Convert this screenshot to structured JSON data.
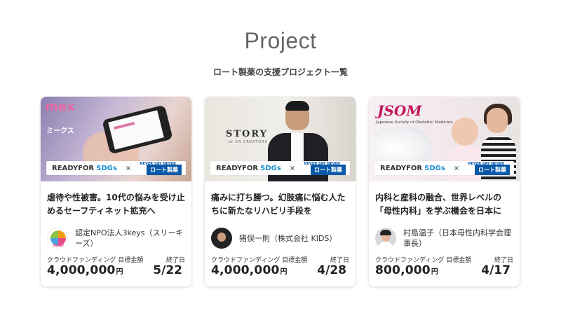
{
  "page": {
    "title": "Project",
    "subtitle": "ロート製薬の支援プロジェクト一覧"
  },
  "badge": {
    "readyfor": "READYFOR",
    "sdgs": "SDGs",
    "times": "×",
    "never_say_never": "NEVER SAY NEVER",
    "rohto": "ロート製薬"
  },
  "labels": {
    "crowdfunding": "クラウドファンディング",
    "goal_amount": "目標金額",
    "end_date": "終了日",
    "yen": "円"
  },
  "cards": [
    {
      "title": "虐待や性被害。10代の悩みを受け止めるセーフティネット拡充へ",
      "owner": "認定NPO法人3keys（スリーキーズ）",
      "amount": "4,000,000",
      "end": "5/22",
      "thumb_logo": "mex",
      "thumb_logo_sub": "ミークス",
      "owner_logo": "3keys"
    },
    {
      "title": "痛みに打ち勝つ。幻肢痛に悩む人たちに新たなリハビリ手段を",
      "owner": "猪俣一則（株式会社 KIDS）",
      "amount": "4,000,000",
      "end": "4/28",
      "thumb_logo": "STORY",
      "thumb_logo_sub": "of XR CREATORS"
    },
    {
      "title": "内科と産科の融合、世界レベルの「母性内科」を学ぶ機会を日本に",
      "owner": "村島温子（日本母性内科学会理事長）",
      "amount": "800,000",
      "end": "4/17",
      "thumb_logo": "JSOM",
      "thumb_logo_sub": "Japanese Society of Obstetric Medicine"
    }
  ]
}
